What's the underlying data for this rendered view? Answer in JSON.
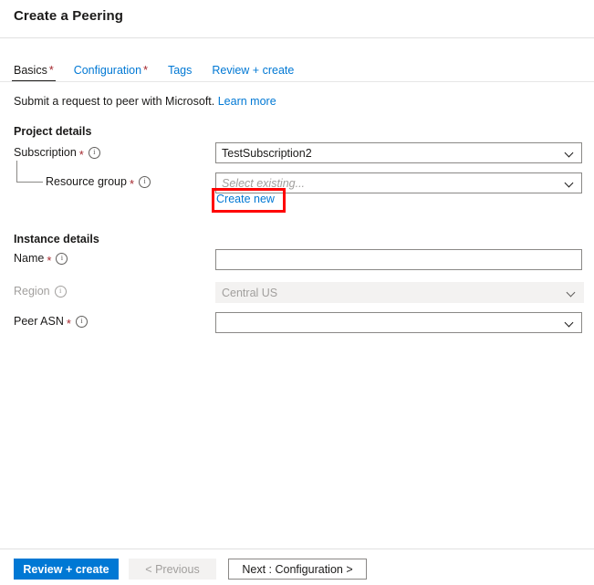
{
  "page": {
    "title": "Create a Peering",
    "subtitle_text": "Submit a request to peer with Microsoft.",
    "learn_more_label": "Learn more"
  },
  "tabs": [
    {
      "label": "Basics",
      "required_marker": "*",
      "active": true
    },
    {
      "label": "Configuration",
      "required_marker": "*",
      "active": false
    },
    {
      "label": "Tags",
      "required_marker": "",
      "active": false
    },
    {
      "label": "Review + create",
      "required_marker": "",
      "active": false
    }
  ],
  "sections": {
    "project_details": {
      "heading": "Project details",
      "fields": {
        "subscription": {
          "label": "Subscription",
          "required_marker": "*",
          "value": "TestSubscription2",
          "icon": "info-icon",
          "chevron": "chevron-down-icon"
        },
        "resource_group": {
          "label": "Resource group",
          "required_marker": "*",
          "placeholder": "Select existing...",
          "value": "",
          "icon": "info-icon",
          "chevron": "chevron-down-icon",
          "create_new_label": "Create new"
        }
      }
    },
    "instance_details": {
      "heading": "Instance details",
      "fields": {
        "name": {
          "label": "Name",
          "required_marker": "*",
          "value": "",
          "icon": "info-icon"
        },
        "region": {
          "label": "Region",
          "required_marker": "",
          "value": "Central US",
          "disabled": true,
          "icon": "info-icon",
          "chevron": "chevron-down-icon"
        },
        "peer_asn": {
          "label": "Peer ASN",
          "required_marker": "*",
          "value": "",
          "icon": "info-icon",
          "chevron": "chevron-down-icon"
        }
      }
    }
  },
  "footer": {
    "review_create_label": "Review + create",
    "previous_label": "< Previous",
    "next_label": "Next : Configuration >"
  },
  "colors": {
    "accent": "#0078d4",
    "required_star": "#a4262c",
    "highlight_box": "#ff0000",
    "disabled_text": "#a19f9d",
    "border": "#8a8886"
  }
}
